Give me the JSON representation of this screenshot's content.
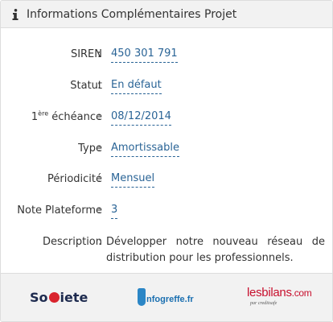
{
  "header": {
    "title": "Informations Complémentaires Projet",
    "icon": "info-icon"
  },
  "fields": {
    "siren": {
      "label": "SIREN",
      "value": "450 301 791"
    },
    "statut": {
      "label": "Statut",
      "value": "En défaut"
    },
    "echeance": {
      "label_prefix": "1",
      "label_sup": "ère",
      "label_suffix": " échéance",
      "value": "08/12/2014"
    },
    "type": {
      "label": "Type",
      "value": "Amortissable"
    },
    "periodicite": {
      "label": "Périodicité",
      "value": "Mensuel"
    },
    "note": {
      "label": "Note Plateforme",
      "value": "3"
    },
    "description": {
      "label": "Description",
      "value": "Développer notre nouveau réseau de distribution pour les professionnels."
    }
  },
  "colon": ":",
  "footer": {
    "societe": {
      "part1": "So",
      "part2": "iete"
    },
    "infogreffe": {
      "text": "nfogreffe.fr"
    },
    "lesbilans": {
      "main": "lesbilans",
      "tld": ".com",
      "sub": "par creditsafe"
    }
  },
  "colors": {
    "link": "#2a6496",
    "header_bg": "#f2f2f2",
    "border": "#dddddd",
    "societe_dark": "#1d2a4e",
    "societe_red": "#d9232d",
    "infogreffe_blue": "#1a6fb0",
    "lesbilans_red": "#c8102e"
  }
}
